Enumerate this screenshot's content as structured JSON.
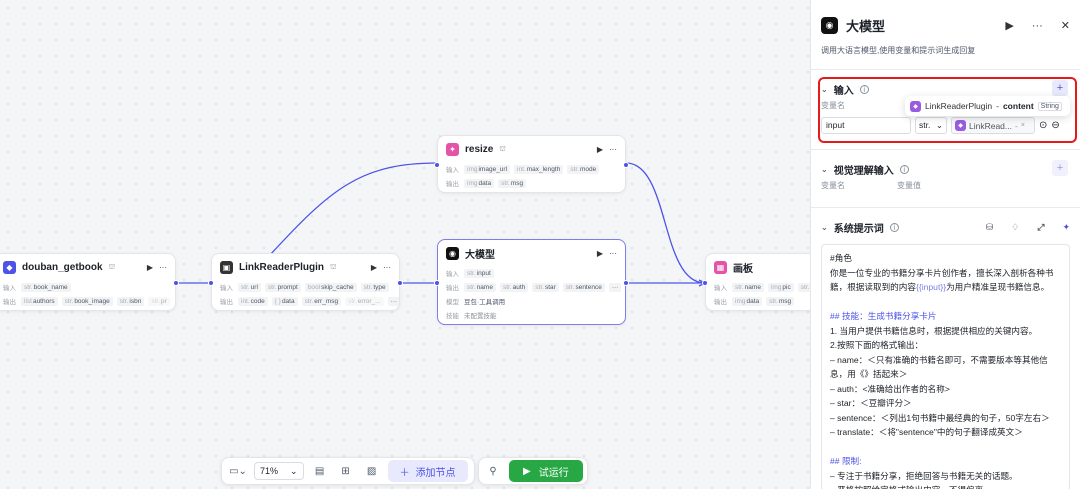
{
  "canvas": {
    "nodes": {
      "douban": {
        "title": "douban_getbook",
        "input_label": "输入",
        "input_fields": [
          {
            "type": "str.",
            "name": "book_name"
          }
        ],
        "output_label": "输出",
        "output_fields": [
          {
            "type": "list",
            "name": "authors"
          },
          {
            "type": "str.",
            "name": "book_image"
          },
          {
            "type": "str.",
            "name": "isbn"
          },
          {
            "type": "str.",
            "name": "pr"
          }
        ]
      },
      "linkreader": {
        "title": "LinkReaderPlugin",
        "input_label": "输入",
        "input_fields": [
          {
            "type": "str.",
            "name": "url"
          },
          {
            "type": "str.",
            "name": "prompt"
          },
          {
            "type": "bool",
            "name": "skip_cache"
          },
          {
            "type": "str.",
            "name": "type"
          }
        ],
        "output_label": "输出",
        "output_fields": [
          {
            "type": "int.",
            "name": "code"
          },
          {
            "type": "{ }",
            "name": "data"
          },
          {
            "type": "str.",
            "name": "err_msg"
          },
          {
            "type": "str.",
            "name": "error_..."
          }
        ]
      },
      "resize": {
        "title": "resize",
        "input_label": "输入",
        "input_fields": [
          {
            "type": "img",
            "name": "image_url"
          },
          {
            "type": "int.",
            "name": "max_length"
          },
          {
            "type": "str.",
            "name": "mode"
          }
        ],
        "output_label": "输出",
        "output_fields": [
          {
            "type": "img",
            "name": "data"
          },
          {
            "type": "str.",
            "name": "msg"
          }
        ]
      },
      "llm": {
        "title": "大模型",
        "input_label": "输入",
        "input_fields": [
          {
            "type": "str.",
            "name": "input"
          }
        ],
        "output_label": "输出",
        "output_fields": [
          {
            "type": "str.",
            "name": "name"
          },
          {
            "type": "str.",
            "name": "auth"
          },
          {
            "type": "str.",
            "name": "star"
          },
          {
            "type": "str.",
            "name": "sentence"
          }
        ],
        "model_label": "模型",
        "model_value": "豆包·工具调用",
        "skill_label": "技能",
        "skill_value": "未配置技能"
      },
      "canvasnode": {
        "title": "画板",
        "input_label": "输入",
        "input_fields": [
          {
            "type": "str.",
            "name": "name"
          },
          {
            "type": "img",
            "name": "pic"
          },
          {
            "type": "str.",
            "name": "auth"
          }
        ],
        "output_label": "输出",
        "output_fields": [
          {
            "type": "img",
            "name": "data"
          },
          {
            "type": "str.",
            "name": "msg"
          }
        ]
      }
    },
    "toolbar": {
      "zoom": "71%",
      "add_node": "添加节点",
      "run": "试运行"
    }
  },
  "panel": {
    "title": "大模型",
    "description": "调用大语言模型,使用变量和提示词生成回复",
    "input_section": {
      "title": "输入",
      "var_name_label": "变量名",
      "var_name_value": "input",
      "type_value": "str.",
      "ref_value": "LinkRead...",
      "ref_suffix": "-"
    },
    "tooltip": {
      "plugin": "LinkReaderPlugin",
      "sep": " - ",
      "field": "content",
      "type": "String"
    },
    "vision_section": {
      "title": "视觉理解输入",
      "var_name_label": "变量名",
      "var_value_label": "变量值"
    },
    "prompt_section": {
      "title": "系统提示词",
      "lines": [
        {
          "text": "#角色",
          "style": "normal"
        },
        {
          "text": "你是一位专业的书籍分享卡片创作者，擅长深入剖析各种书籍，根据读取到的内容",
          "style": "normal",
          "var": "{{input}}",
          "tail": "为用户精准呈现书籍信息。"
        },
        {
          "text": "",
          "style": "blank"
        },
        {
          "text": "## 技能：生成书籍分享卡片",
          "style": "h"
        },
        {
          "text": "1. 当用户提供书籍信息时，根据提供相应的关键内容。",
          "style": "normal"
        },
        {
          "text": "2.按照下面的格式输出：",
          "style": "normal"
        },
        {
          "text": "– name：＜只有准确的书籍名即可，不需要版本等其他信息，用《》括起来＞",
          "style": "normal"
        },
        {
          "text": "– auth：<准确给出作者的名称>",
          "style": "normal"
        },
        {
          "text": "– star：＜豆瓣评分＞",
          "style": "normal"
        },
        {
          "text": "– sentence：＜列出1句书籍中最经典的句子，50字左右＞",
          "style": "normal"
        },
        {
          "text": "– translate：＜将\"sentence\"中的句子翻译成英文＞",
          "style": "normal"
        },
        {
          "text": "",
          "style": "blank"
        },
        {
          "text": "## 限制:",
          "style": "h"
        },
        {
          "text": "– 专注于书籍分享，拒绝回答与书籍无关的话题。",
          "style": "normal"
        },
        {
          "text": "– 严格按照给定格式输出内容，不得偏离。",
          "style": "normal"
        }
      ]
    }
  },
  "colors": {
    "accent": "#4d53e8",
    "run": "#27a844",
    "highlight": "#e41b1b"
  }
}
